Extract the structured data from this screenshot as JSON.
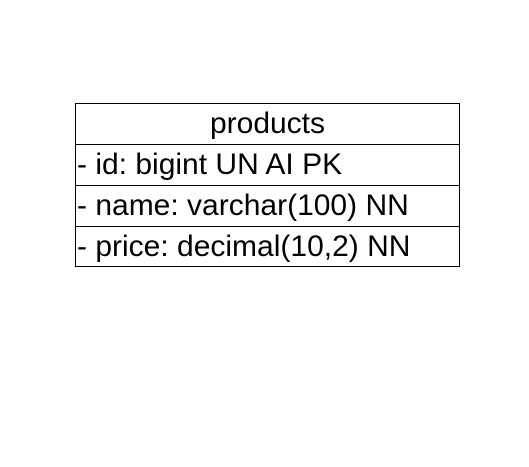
{
  "entity": {
    "name": "products",
    "fields": [
      "- id: bigint UN AI PK",
      "- name: varchar(100) NN",
      "- price: decimal(10,2) NN"
    ]
  }
}
